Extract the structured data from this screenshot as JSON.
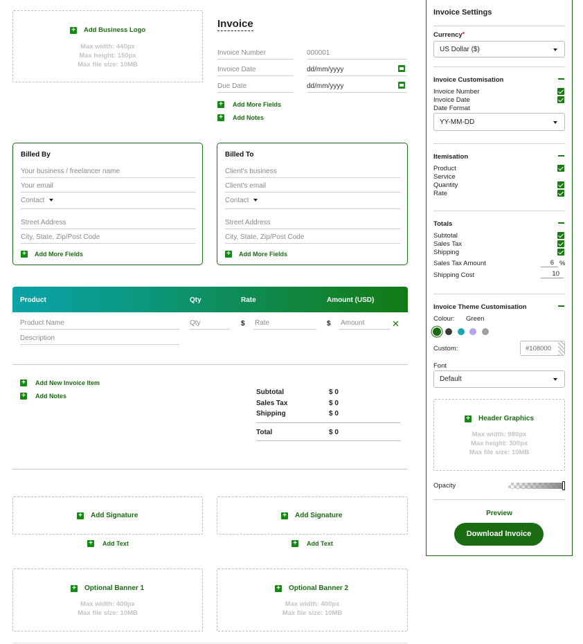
{
  "logo": {
    "add_label": "Add Business Logo",
    "max_width": "Max width: 440px",
    "max_height": "Max height: 150px",
    "max_size": "Max file size: 10MB"
  },
  "invoice": {
    "title": "Invoice",
    "number_label": "Invoice Number",
    "number_value": "000001",
    "date_label": "Invoice Date",
    "date_value": "dd/mm/yyyy",
    "due_label": "Due Date",
    "due_value": "dd/mm/yyyy",
    "add_more_fields": "Add More Fields",
    "add_notes": "Add Notes"
  },
  "billed_by": {
    "title": "Billed By",
    "name_placeholder": "Your business / freelancer name",
    "email_placeholder": "Your email",
    "contact": "Contact",
    "street": "Street Address",
    "city": "City, State, Zip/Post Code",
    "add_more": "Add More Fields"
  },
  "billed_to": {
    "title": "Billed To",
    "name_placeholder": "Client's business",
    "email_placeholder": "Client's email",
    "contact": "Contact",
    "street": "Street Address",
    "city": "City, State, Zip/Post Code",
    "add_more": "Add More Fields"
  },
  "items": {
    "headers": {
      "product": "Product",
      "qty": "Qty",
      "rate": "Rate",
      "amount": "Amount (USD)"
    },
    "row": {
      "product": "Product Name",
      "description": "Description",
      "qty": "Qty",
      "currency": "$",
      "rate": "Rate",
      "amount": "Amount"
    },
    "add_item": "Add New Invoice Item",
    "add_notes": "Add Notes",
    "header_gradient": [
      "#0aa3a8",
      "#137a12"
    ]
  },
  "totals": {
    "subtotal_label": "Subtotal",
    "subtotal_value": "$ 0",
    "tax_label": "Sales Tax",
    "tax_value": "$ 0",
    "shipping_label": "Shipping",
    "shipping_value": "$ 0",
    "total_label": "Total",
    "total_value": "$ 0"
  },
  "signatures": [
    {
      "label": "Add Signature",
      "add_text": "Add Text"
    },
    {
      "label": "Add Signature",
      "add_text": "Add Text"
    }
  ],
  "banners": [
    {
      "label": "Optional Banner 1",
      "max_width": "Max width: 400px",
      "max_size": "Max file size: 10MB"
    },
    {
      "label": "Optional Banner 2",
      "max_width": "Max width: 400px",
      "max_size": "Max file size: 10MB"
    }
  ],
  "settings": {
    "title": "Invoice Settings",
    "currency_label": "Currency",
    "required_mark": "*",
    "currency_value": "US Dollar ($)",
    "customisation": {
      "title": "Invoice Customisation",
      "invoice_number": "Invoice Number",
      "invoice_date": "Invoice Date",
      "date_format_label": "Date Format",
      "date_format_value": "YY-MM-DD"
    },
    "itemisation": {
      "title": "Itemisation",
      "product": "Product",
      "service": "Service",
      "quantity": "Quantity",
      "rate": "Rate"
    },
    "totals": {
      "title": "Totals",
      "subtotal": "Subtotal",
      "sales_tax": "Sales Tax",
      "shipping": "Shipping",
      "tax_amount_label": "Sales Tax Amount",
      "tax_amount_value": "6",
      "tax_unit": "%",
      "shipping_cost_label": "Shipping Cost",
      "shipping_cost_value": "10"
    },
    "theme": {
      "title": "Invoice Theme Customisation",
      "colour_label": "Colour:",
      "colour_value": "Green",
      "swatches": [
        "#1a6b12",
        "#3a3a3a",
        "#19a4b4",
        "#b9a3f0",
        "#a0a0a0"
      ],
      "custom_label": "Custom:",
      "custom_value": "#108000",
      "font_label": "Font",
      "font_value": "Default"
    },
    "header_graphics": {
      "label": "Header Graphics",
      "max_width": "Max width: 980px",
      "max_height": "Max height: 300px",
      "max_size": "Max file size: 10MB"
    },
    "opacity_label": "Opacity",
    "preview": "Preview",
    "download": "Download Invoice",
    "accent": "#1a6b12"
  }
}
